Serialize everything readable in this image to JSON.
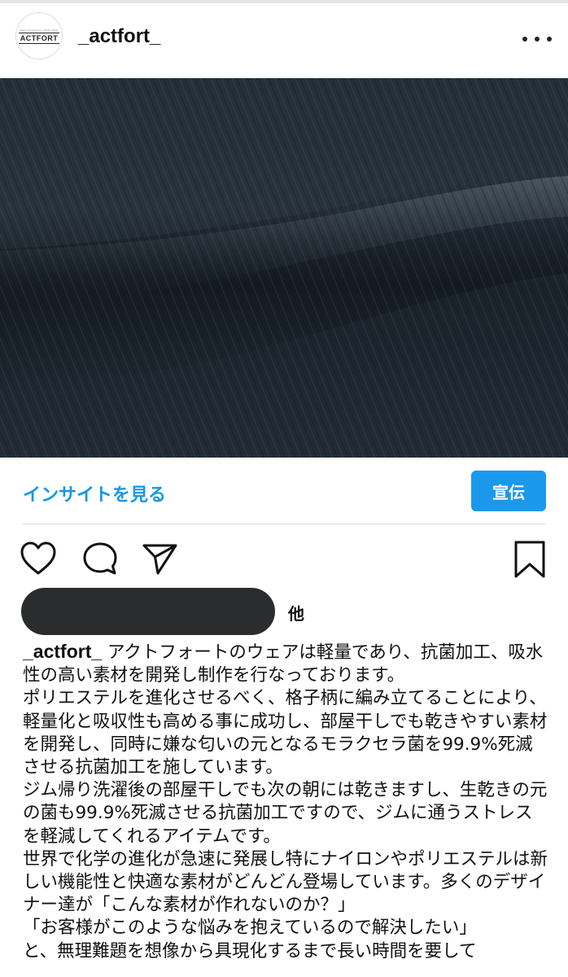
{
  "post": {
    "username": "_actfort_",
    "avatar": {
      "brand": "ACTFORT",
      "tagline": "Well-functioning urban wear"
    },
    "more_icon": "more-horizontal-icon"
  },
  "media": {
    "kind": "fabric-close-up-photo",
    "colors": {
      "base": "#2a353e",
      "highlight": "#4a5762",
      "shadow": "#141b22"
    }
  },
  "insights": {
    "link_label": "インサイトを見る",
    "ad_label": "宣伝",
    "accent_color": "#1a98ec"
  },
  "actions": {
    "like_icon": "heart-icon",
    "comment_icon": "comment-icon",
    "share_icon": "paper-plane-icon",
    "save_icon": "bookmark-icon"
  },
  "likes": {
    "suffix": "他"
  },
  "caption": {
    "handle": "_actfort_",
    "paragraphs": [
      "アクトフォートのウェアは軽量であり、抗菌加工、吸水性の高い素材を開発し制作を行なっております。",
      "ポリエステルを進化させるべく、格子柄に編み立てることにより、軽量化と吸収性も高める事に成功し、部屋干しでも乾きやすい素材を開発し、同時に嫌な匂いの元となるモラクセラ菌を99.9%死滅させる抗菌加工を施しています。",
      "ジム帰り洗濯後の部屋干しでも次の朝には乾きますし、生乾きの元の菌も99.9%死滅させる抗菌加工ですので、ジムに通うストレスを軽減してくれるアイテムです。",
      "世界で化学の進化が急速に発展し特にナイロンやポリエステルは新しい機能性と快適な素材がどんどん登場しています。多くのデザイナー達が「こんな素材が作れないのか？」",
      "「お客様がこのような悩みを抱えているので解決したい」",
      "と、無理難題を想像から具現化するまで長い時間を要して"
    ]
  }
}
